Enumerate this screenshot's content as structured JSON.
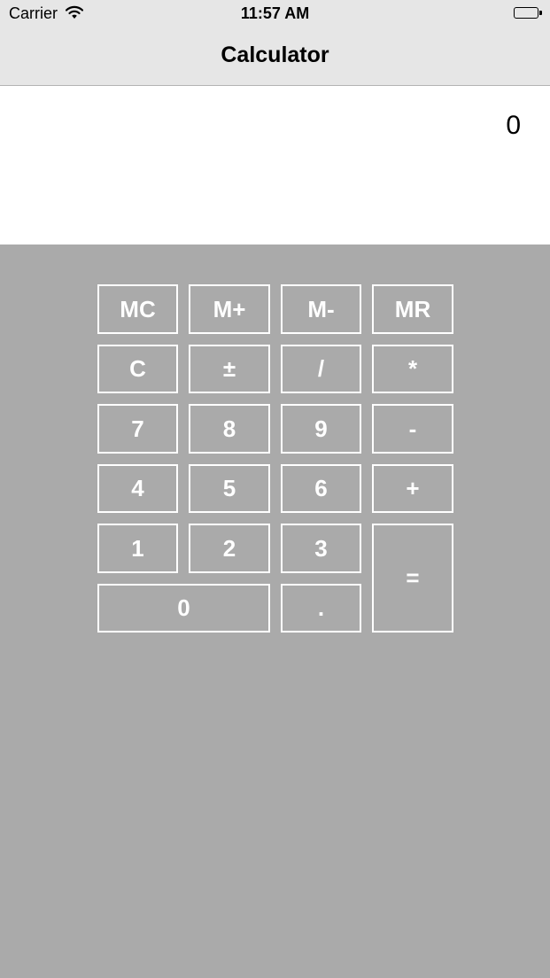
{
  "status_bar": {
    "carrier": "Carrier",
    "time": "11:57 AM"
  },
  "nav": {
    "title": "Calculator"
  },
  "display": {
    "value": "0"
  },
  "keys": {
    "mc": "MC",
    "m_plus": "M+",
    "m_minus": "M-",
    "mr": "MR",
    "clear": "C",
    "plus_minus": "±",
    "divide": "/",
    "multiply": "*",
    "seven": "7",
    "eight": "8",
    "nine": "9",
    "minus": "-",
    "four": "4",
    "five": "5",
    "six": "6",
    "plus": "+",
    "one": "1",
    "two": "2",
    "three": "3",
    "equals": "=",
    "zero": "0",
    "decimal": "."
  },
  "colors": {
    "keypad_background": "#aaaaaa",
    "bar_background": "#e6e6e6",
    "key_border": "#ffffff"
  },
  "icons": [
    "wifi-icon",
    "battery-icon"
  ]
}
